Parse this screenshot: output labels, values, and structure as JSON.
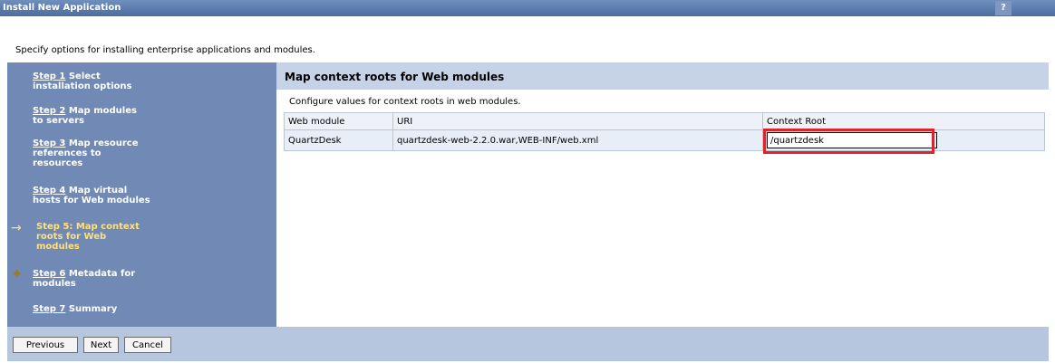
{
  "window": {
    "title": "Install New Application",
    "help": "?"
  },
  "intro": "Specify options for installing enterprise applications and modules.",
  "steps": [
    {
      "link": "Step 1",
      "rest": " Select",
      "line2": "installation options"
    },
    {
      "link": "Step 2",
      "rest": " Map modules",
      "line2": "to servers"
    },
    {
      "link": "Step 3",
      "rest": " Map resource",
      "line2": "references to",
      "line3": "resources"
    },
    {
      "link": "Step 4",
      "rest": " Map virtual",
      "line2": "hosts for Web modules"
    },
    {
      "text": "Step 5: Map context",
      "line2": "roots for Web",
      "line3": "modules"
    },
    {
      "link": "Step 6",
      "rest": " Metadata for",
      "line2": "modules"
    },
    {
      "link": "Step 7",
      "rest": " Summary"
    }
  ],
  "main": {
    "heading": "Map context roots for Web modules",
    "description": "Configure values for context roots in web modules.",
    "columns": [
      "Web module",
      "URI",
      "Context Root"
    ],
    "row": {
      "module": "QuartzDesk",
      "uri": "quartzdesk-web-2.2.0.war,WEB-INF/web.xml",
      "context_root": "/quartzdesk"
    }
  },
  "buttons": {
    "previous": "Previous",
    "next": "Next",
    "cancel": "Cancel"
  }
}
